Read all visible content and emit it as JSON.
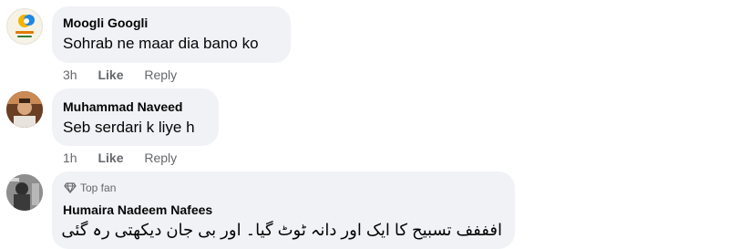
{
  "comments": [
    {
      "author": "Moogli Googli",
      "text": "Sohrab ne maar dia bano ko",
      "time": "3h",
      "like_label": "Like",
      "reply_label": "Reply"
    },
    {
      "author": "Muhammad Naveed",
      "text": "Seb serdari k liye h",
      "time": "1h",
      "like_label": "Like",
      "reply_label": "Reply"
    },
    {
      "badge": "Top fan",
      "author": "Humaira Nadeem Nafees",
      "text": "افففف تسبیح کا ایک اور دانہ ٹوٹ گیا۔ اور بی جان دیکھتی رہ گئی"
    }
  ],
  "colors": {
    "bubble": "#f0f2f5",
    "author": "#050505",
    "meta": "#65676b"
  },
  "icons": [
    "diamond-icon"
  ]
}
